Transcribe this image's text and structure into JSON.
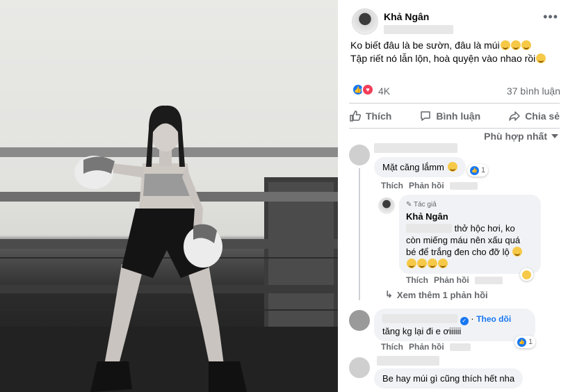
{
  "post": {
    "author": "Khả Ngân",
    "caption_line1": "Ko biết đâu là be sườn, đâu là múi",
    "caption_line2": "Tập riết nó lẫn lộn, hoà quyện vào nhao rồi",
    "reaction_count": "4K",
    "comment_count": "37 bình luận",
    "actions": {
      "like": "Thích",
      "comment": "Bình luận",
      "share": "Chia sẻ"
    },
    "sort_label": "Phù hợp nhất"
  },
  "comments": [
    {
      "text": "Mặt căng lắmm",
      "react_count": "1",
      "like_label": "Thích",
      "reply_label": "Phản hồi"
    },
    {
      "author_badge": "Tác giả",
      "author": "Khả Ngân",
      "text_line1": "thở hộc hơi, ko",
      "text_line2": "còn miếng máu nên xấu quá",
      "text_line3": "bé để trắng đen cho đỡ lộ",
      "like_label": "Thích",
      "reply_label": "Phản hồi"
    },
    {
      "more_replies": "Xem thêm 1 phản hồi"
    },
    {
      "follow_label": "Theo dõi",
      "text": "tăng kg lại đi e ơiiiiii",
      "react_count": "1",
      "like_label": "Thích",
      "reply_label": "Phản hồi"
    },
    {
      "text": "Be hay múi gì cũng thích hết nha"
    }
  ],
  "colors": {
    "accent": "#1877f2",
    "secondary_text": "#65676b",
    "bubble": "#f0f2f5"
  }
}
